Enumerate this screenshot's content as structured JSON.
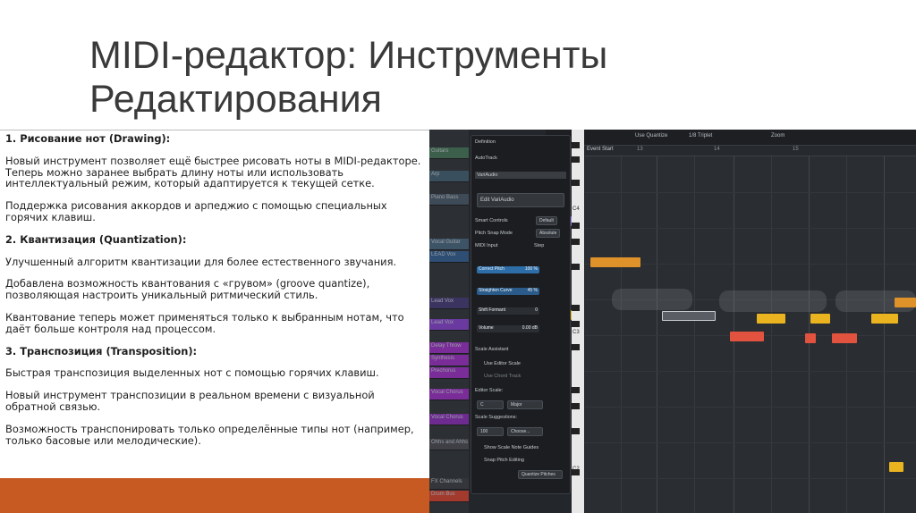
{
  "slide": {
    "title_line1": "MIDI-редактор: Инструменты",
    "title_line2": "Редактирования"
  },
  "content": {
    "s1_heading": "1. Рисование нот (Drawing):",
    "s1_p1": "Новый инструмент позволяет ещё быстрее рисовать ноты в MIDI-редакторе. Теперь можно заранее выбрать длину ноты или использовать интеллектуальный режим, который адаптируется к текущей сетке.",
    "s1_p2": "Поддержка рисования аккордов и арпеджио с помощью специальных горячих клавиш.",
    "s2_heading": "2. Квантизация (Quantization):",
    "s2_p1": "Улучшенный алгоритм квантизации для более естественного звучания.",
    "s2_p2": "Добавлена возможность квантования с «грувом» (groove quantize), позволяющая настроить уникальный ритмический стиль.",
    "s2_p3": "Квантование теперь может применяться только к выбранным нотам, что даёт больше контроля над процессом.",
    "s3_heading": "3. Транспозиция (Transposition):",
    "s3_p1": "Быстрая транспозиция выделенных нот с помощью горячих клавиш.",
    "s3_p2": "Новый инструмент транспозиции в реальном времени с визуальной обратной связью.",
    "s3_p3": "Возможность транспонировать только определённые типы нот (например, только басовые или мелодические)."
  },
  "screenshot": {
    "tracks": [
      "Guitars",
      "Arp",
      "Piano Bass",
      "Vocal Guitar",
      "LEAD Vox",
      "Lead Vox",
      "Lead Vox",
      "Delay Throw",
      "Synthesis",
      "Prechorus",
      "Vocal Chorus",
      "Vocal Chorus",
      "Ohhs and Ahhs",
      "FX Channels",
      "Drum Bus"
    ],
    "toolbar": {
      "quantize": "Use Quantize",
      "length": "1/8 Triplet",
      "zoom": "Zoom"
    },
    "ruler": [
      "Event Start",
      "13",
      "14",
      "15"
    ],
    "inspector": {
      "definition": "Definition",
      "autotrack": "AutoTrack",
      "varaudio": "VariAudio",
      "edit_varaudio": "Edit VariAudio",
      "smart_controls": "Smart Controls",
      "smart_value": "Default",
      "pitch_snap": "Pitch Snap Mode",
      "pitch_snap_value": "Absolute",
      "midi_input": "MIDI Input",
      "step": "Step",
      "correct_pitch": "Correct Pitch",
      "correct_pitch_val": "100 %",
      "straighten_curve": "Straighten Curve",
      "straighten_val": "45 %",
      "shift_formant": "Shift Formant",
      "shift_formant_val": "0",
      "volume": "Volume",
      "volume_val": "0.00 dB",
      "scale_assistant": "Scale Assistant",
      "use_editor_scale": "Use Editor Scale",
      "use_chord_track": "Use Chord Track",
      "editor_scale": "Editor Scale:",
      "scale_root": "C",
      "scale_type": "Major",
      "scale_suggestions": "Scale Suggestions:",
      "suggestion_count": "100",
      "choose": "Choose...",
      "show_guides": "Show Scale Note Guides",
      "snap_pitch": "Snap Pitch Editing",
      "quantize_pitches": "Quantize Pitches"
    },
    "keys": [
      "C4",
      "C3",
      "C2"
    ],
    "colors": {
      "bottom_bar": "#c65a22",
      "note_orange": "#e0922a",
      "note_yellow": "#e9b420",
      "note_red": "#e2533f",
      "note_purple": "#8f78d8",
      "slider_blue": "#2d6ea8"
    }
  }
}
